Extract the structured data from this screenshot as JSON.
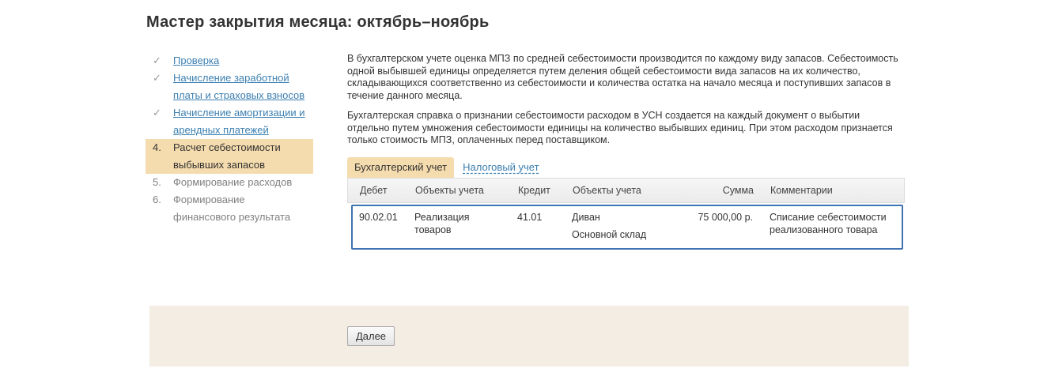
{
  "window": {
    "title": "Мастер закрытия месяца: октябрь–ноябрь"
  },
  "steps": [
    {
      "mark": "✓",
      "label": "Проверка",
      "state": "done"
    },
    {
      "mark": "✓",
      "label": "Начисление заработной платы и страховых взносов",
      "state": "done"
    },
    {
      "mark": "✓",
      "label": "Начисление амортизации и арендных платежей",
      "state": "done"
    },
    {
      "mark": "4.",
      "label": "Расчет себестоимости выбывших запасов",
      "state": "current"
    },
    {
      "mark": "5.",
      "label": "Формирование расходов",
      "state": "pending"
    },
    {
      "mark": "6.",
      "label": "Формирование финансового результата",
      "state": "pending"
    }
  ],
  "main": {
    "paragraph1": "В бухгалтерском учете оценка МПЗ по средней себестоимости производится по каждому виду запасов. Себестоимость одной выбывшей единицы определяется путем деления общей себестоимости вида запасов на их количество, складывающихся соответственно из себестоимости и количества остатка на начало месяца и поступивших запасов в течение данного месяца.",
    "paragraph2": "Бухгалтерская справка о признании себестоимости расходом в УСН создается на каждый документ о выбытии отдельно путем умножения себестоимости единицы на количество выбывших единиц. При этом расходом признается только стоимость МПЗ, оплаченных перед поставщиком.",
    "tabs": [
      {
        "label": "Бухгалтерский учет",
        "active": true
      },
      {
        "label": "Налоговый учет",
        "active": false
      }
    ]
  },
  "table": {
    "columns": [
      "Дебет",
      "Объекты учета",
      "Кредит",
      "Объекты учета",
      "Сумма",
      "Комментарии"
    ],
    "rows": [
      {
        "debit": "90.02.01",
        "debit_objects": "Реализация товаров",
        "credit": "41.01",
        "credit_objects_1": "Диван",
        "credit_objects_2": "Основной склад",
        "amount": "75 000,00 р.",
        "comment": "Списание себестоимости реализованного товара"
      }
    ]
  },
  "footer": {
    "next_label": "Далее"
  },
  "colors": {
    "accent_highlight": "#f5dcae",
    "link": "#3c7fb1",
    "row_border": "#3f73b1",
    "footer_bg": "#f3ede3"
  }
}
